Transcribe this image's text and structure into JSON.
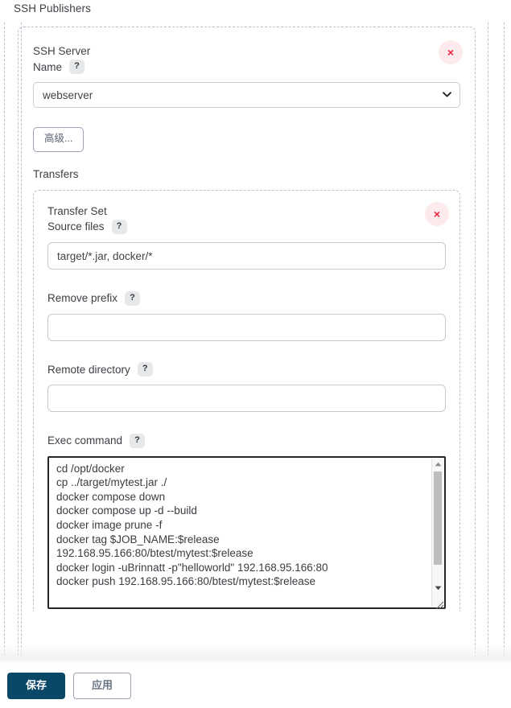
{
  "page": {
    "title": "SSH Publishers"
  },
  "ssh_block": {
    "close_label": "×",
    "server_name_label": "SSH Server\nName",
    "server_name_label_line1": "SSH Server",
    "server_name_label_line2": "Name",
    "help_glyph": "?",
    "server_select": {
      "value": "webserver",
      "options": [
        "webserver"
      ]
    },
    "advanced_button": "高级...",
    "transfers_label": "Transfers"
  },
  "transfer_set": {
    "close_label": "×",
    "title": "Transfer Set",
    "fields": {
      "source_files": {
        "label": "Source files",
        "value": "target/*.jar, docker/*",
        "placeholder": ""
      },
      "remove_prefix": {
        "label": "Remove prefix",
        "value": "",
        "placeholder": ""
      },
      "remote_directory": {
        "label": "Remote directory",
        "value": "",
        "placeholder": ""
      },
      "exec_command": {
        "label": "Exec command",
        "value": "cd /opt/docker\ncp ../target/mytest.jar ./\ndocker compose down\ndocker compose up -d --build\ndocker image prune -f\ndocker tag $JOB_NAME:$release\n192.168.95.166:80/btest/mytest:$release\ndocker login -uBrinnatt -p\"helloworld\" 192.168.95.166:80\ndocker push 192.168.95.166:80/btest/mytest:$release",
        "placeholder": ""
      }
    }
  },
  "footer": {
    "save_label": "保存",
    "apply_label": "应用"
  },
  "colors": {
    "save_button_bg": "#0b4766",
    "close_icon": "#e8243c",
    "close_bg": "#fdeaec",
    "dashed_border": "#b9c2cc",
    "input_border": "#c2cad2",
    "textarea_border": "#262626"
  }
}
